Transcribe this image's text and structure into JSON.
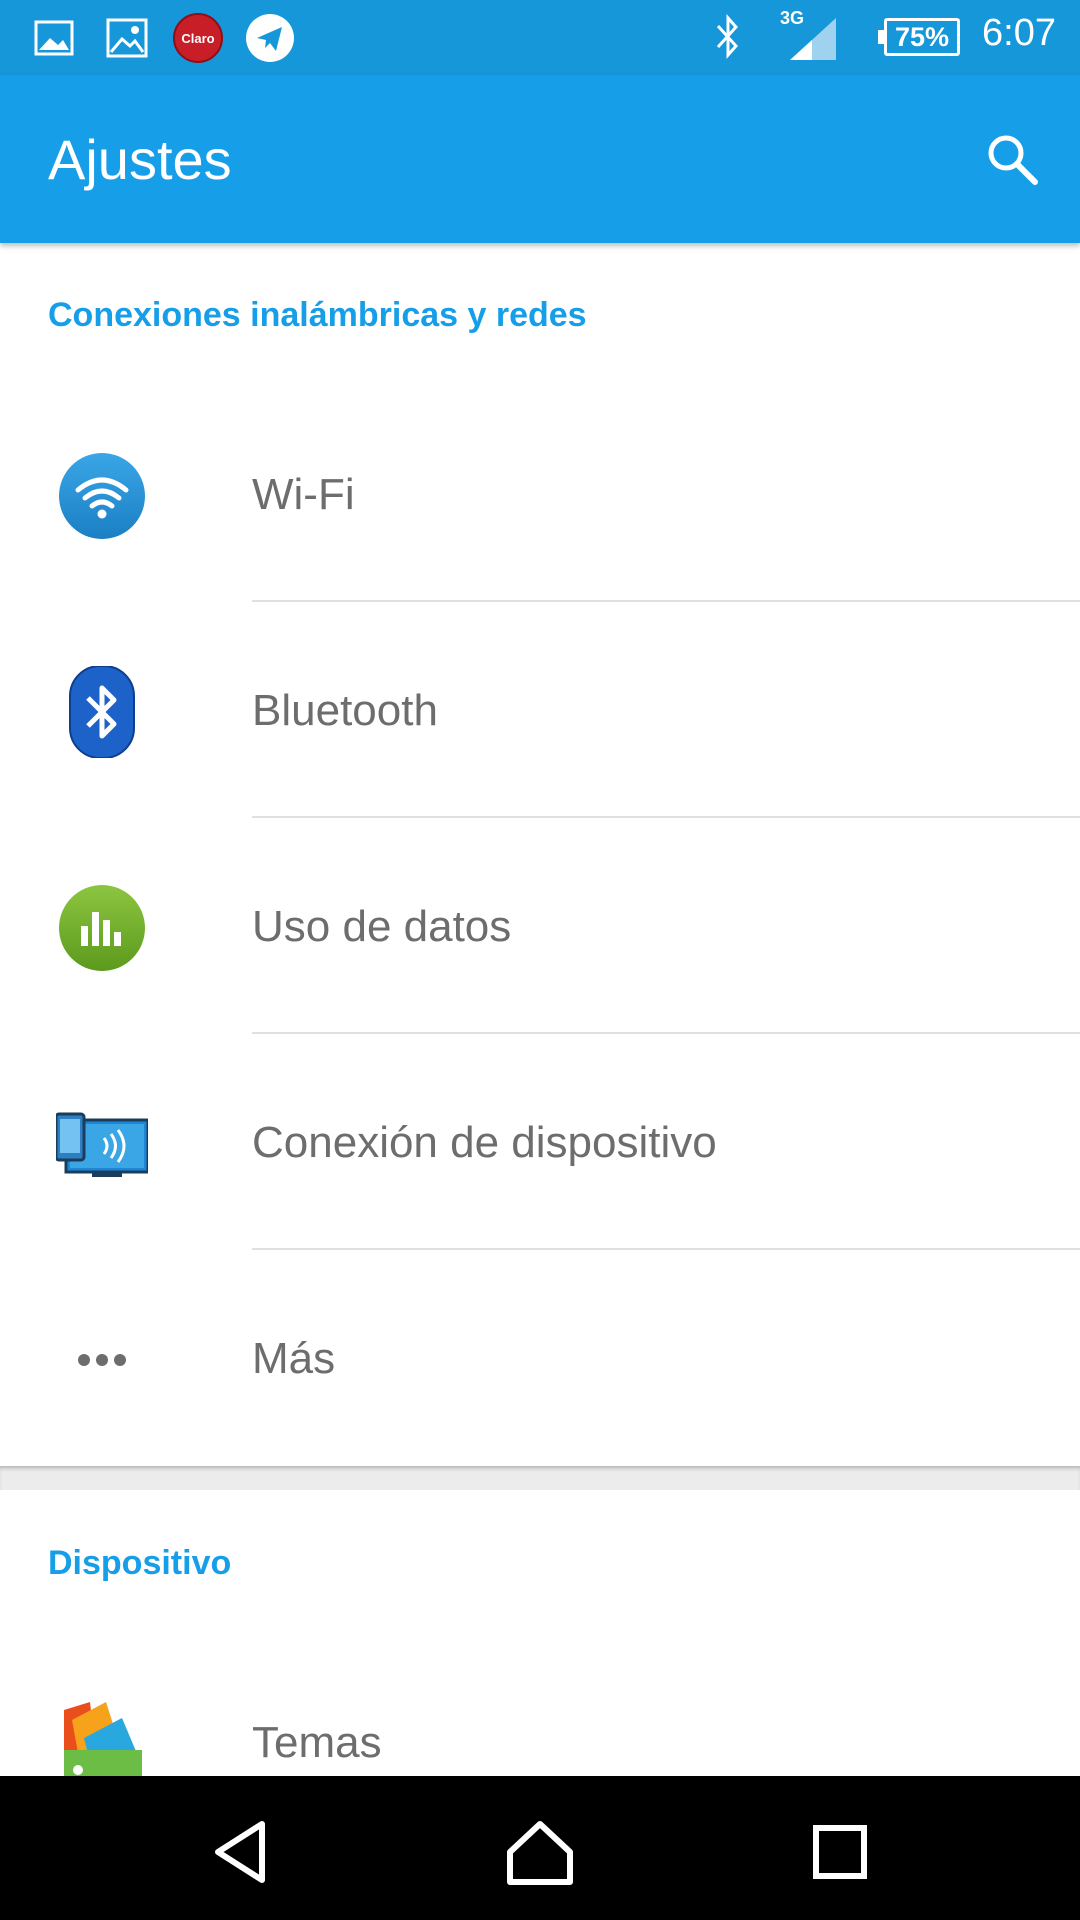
{
  "status_bar": {
    "battery": "75%",
    "time": "6:07",
    "network_type": "3G",
    "carrier_badge": "Claro"
  },
  "app_bar": {
    "title": "Ajustes"
  },
  "sections": [
    {
      "header": "Conexiones inalámbricas y redes",
      "items": [
        {
          "label": "Wi-Fi",
          "icon": "wifi-icon"
        },
        {
          "label": "Bluetooth",
          "icon": "bluetooth-icon"
        },
        {
          "label": "Uso de datos",
          "icon": "data-usage-icon"
        },
        {
          "label": "Conexión de dispositivo",
          "icon": "device-connection-icon"
        },
        {
          "label": "Más",
          "icon": "more-dots-icon"
        }
      ]
    },
    {
      "header": "Dispositivo",
      "items": [
        {
          "label": "Temas",
          "icon": "themes-icon"
        }
      ]
    }
  ],
  "colors": {
    "status_bar": "#1597d9",
    "app_bar": "#169ee9",
    "accent": "#169ee9",
    "label_text": "#6d6d6d"
  }
}
